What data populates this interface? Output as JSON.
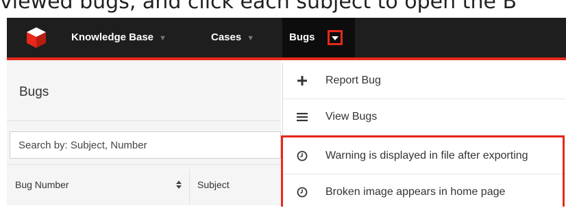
{
  "caption": "viewed bugs, and click each subject to open the B",
  "nav": {
    "items": [
      {
        "label": "Knowledge Base"
      },
      {
        "label": "Cases"
      },
      {
        "label": "Bugs"
      }
    ]
  },
  "page": {
    "title": "Bugs",
    "search_placeholder": "Search by: Subject, Number"
  },
  "table": {
    "columns": [
      "Bug Number",
      "Subject"
    ]
  },
  "menu": {
    "actions": [
      {
        "label": "Report Bug",
        "icon": "plus-icon"
      },
      {
        "label": "View Bugs",
        "icon": "list-icon"
      }
    ],
    "recent": [
      {
        "label": "Warning is displayed in file after exporting",
        "icon": "clock-icon"
      },
      {
        "label": "Broken image appears in home page",
        "icon": "clock-icon"
      }
    ]
  },
  "colors": {
    "topbar": "#1e1e1e",
    "accent": "#e8281a"
  }
}
